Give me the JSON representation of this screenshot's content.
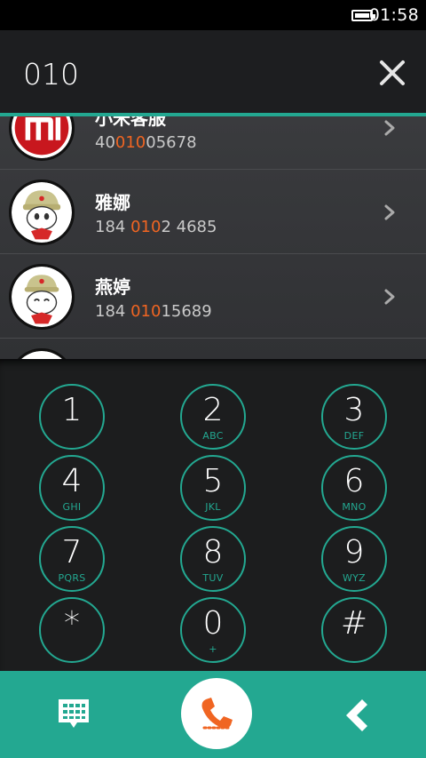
{
  "status_bar": {
    "time": "01:58",
    "battery_icon": "battery-full-icon"
  },
  "dial_header": {
    "number": "010",
    "clear_icon": "close-icon"
  },
  "accent_color": "#23a891",
  "highlight_color": "#f06522",
  "contacts": [
    {
      "name": "小米客服",
      "number_pre": "40",
      "number_match": "010",
      "number_post": "05678",
      "avatar": "mi-logo"
    },
    {
      "name": "雅娜",
      "number_pre": "184 ",
      "number_match": "010",
      "number_post": "2 4685",
      "avatar": "mitu-bunny"
    },
    {
      "name": "燕婷",
      "number_pre": "184 ",
      "number_match": "010",
      "number_post": "15689",
      "avatar": "mitu-bunny"
    }
  ],
  "keypad": [
    {
      "digit": "1",
      "letters": ""
    },
    {
      "digit": "2",
      "letters": "ABC"
    },
    {
      "digit": "3",
      "letters": "DEF"
    },
    {
      "digit": "4",
      "letters": "GHI"
    },
    {
      "digit": "5",
      "letters": "JKL"
    },
    {
      "digit": "6",
      "letters": "MNO"
    },
    {
      "digit": "7",
      "letters": "PQRS"
    },
    {
      "digit": "8",
      "letters": "TUV"
    },
    {
      "digit": "9",
      "letters": "WYZ"
    },
    {
      "digit": "*",
      "letters": ""
    },
    {
      "digit": "0",
      "letters": "+"
    },
    {
      "digit": "#",
      "letters": ""
    }
  ],
  "bottom_bar": {
    "left_icon": "dialpad-icon",
    "center_icon": "phone-icon",
    "right_icon": "backspace-icon"
  }
}
